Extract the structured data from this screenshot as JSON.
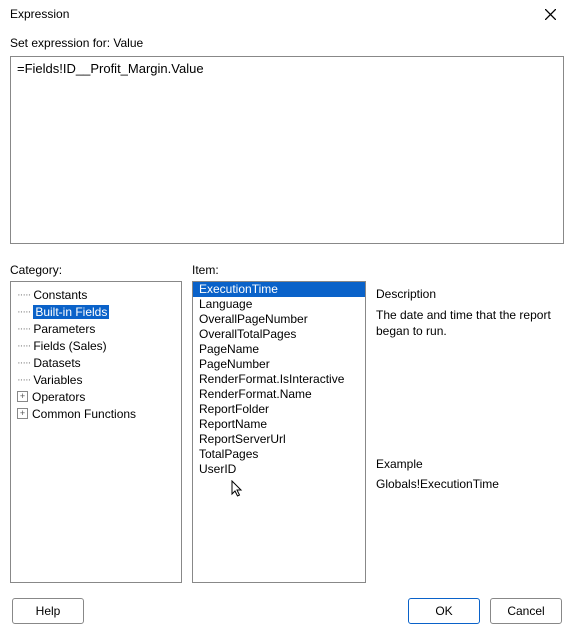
{
  "window": {
    "title": "Expression"
  },
  "set_label": "Set expression for: Value",
  "expression": "=Fields!ID__Profit_Margin.Value",
  "labels": {
    "category": "Category:",
    "item": "Item:",
    "description": "Description",
    "example": "Example"
  },
  "categories": [
    {
      "label": "Constants",
      "expandable": false
    },
    {
      "label": "Built-in Fields",
      "expandable": false,
      "selected": true
    },
    {
      "label": "Parameters",
      "expandable": false
    },
    {
      "label": "Fields (Sales)",
      "expandable": false
    },
    {
      "label": "Datasets",
      "expandable": false
    },
    {
      "label": "Variables",
      "expandable": false
    },
    {
      "label": "Operators",
      "expandable": true
    },
    {
      "label": "Common Functions",
      "expandable": true
    }
  ],
  "items": [
    {
      "label": "ExecutionTime",
      "selected": true
    },
    {
      "label": "Language"
    },
    {
      "label": "OverallPageNumber"
    },
    {
      "label": "OverallTotalPages"
    },
    {
      "label": "PageName"
    },
    {
      "label": "PageNumber"
    },
    {
      "label": "RenderFormat.IsInteractive"
    },
    {
      "label": "RenderFormat.Name"
    },
    {
      "label": "ReportFolder"
    },
    {
      "label": "ReportName"
    },
    {
      "label": "ReportServerUrl"
    },
    {
      "label": "TotalPages"
    },
    {
      "label": "UserID"
    }
  ],
  "description_text": "The date and time that the report began to run.",
  "example_text": "Globals!ExecutionTime",
  "buttons": {
    "help": "Help",
    "ok": "OK",
    "cancel": "Cancel"
  }
}
